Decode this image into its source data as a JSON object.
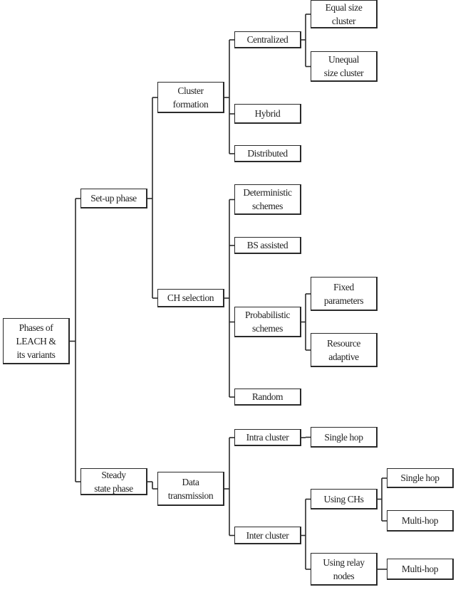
{
  "diagram": {
    "root": {
      "id": "root",
      "label": "Phases of\nLEACH &\nits variants",
      "children": [
        {
          "id": "setup",
          "label": "Set-up phase",
          "children": [
            {
              "id": "clusterformation",
              "label": "Cluster\nformation",
              "children": [
                {
                  "id": "centralized",
                  "label": "Centralized",
                  "children": [
                    {
                      "id": "equal",
                      "label": "Equal size\ncluster"
                    },
                    {
                      "id": "unequal",
                      "label": "Unequal\nsize cluster"
                    }
                  ]
                },
                {
                  "id": "hybrid",
                  "label": "Hybrid"
                },
                {
                  "id": "distributed",
                  "label": "Distributed"
                }
              ]
            },
            {
              "id": "chselection",
              "label": "CH selection",
              "children": [
                {
                  "id": "deterministic",
                  "label": "Deterministic\nschemes"
                },
                {
                  "id": "bsassisted",
                  "label": "BS assisted"
                },
                {
                  "id": "probabilistic",
                  "label": "Probabilistic\nschemes",
                  "children": [
                    {
                      "id": "fixed",
                      "label": "Fixed\nparameters"
                    },
                    {
                      "id": "resource",
                      "label": "Resource\nadaptive"
                    }
                  ]
                },
                {
                  "id": "random",
                  "label": "Random"
                }
              ]
            }
          ]
        },
        {
          "id": "steady",
          "label": "Steady\nstate phase",
          "children": [
            {
              "id": "datatx",
              "label": "Data\ntransmission",
              "children": [
                {
                  "id": "intra",
                  "label": "Intra cluster",
                  "children": [
                    {
                      "id": "intrasingle",
                      "label": "Single hop"
                    }
                  ]
                },
                {
                  "id": "inter",
                  "label": "Inter cluster",
                  "children": [
                    {
                      "id": "usingch",
                      "label": "Using CHs",
                      "children": [
                        {
                          "id": "chsingle",
                          "label": "Single hop"
                        },
                        {
                          "id": "chmulti",
                          "label": "Multi-hop"
                        }
                      ]
                    },
                    {
                      "id": "relay",
                      "label": "Using relay\nnodes",
                      "children": [
                        {
                          "id": "relaymulti",
                          "label": "Multi-hop"
                        }
                      ]
                    }
                  ]
                }
              ]
            }
          ]
        }
      ]
    },
    "colors": {
      "stroke": "#2a2a2a",
      "box_fill": "#ffffff"
    }
  }
}
